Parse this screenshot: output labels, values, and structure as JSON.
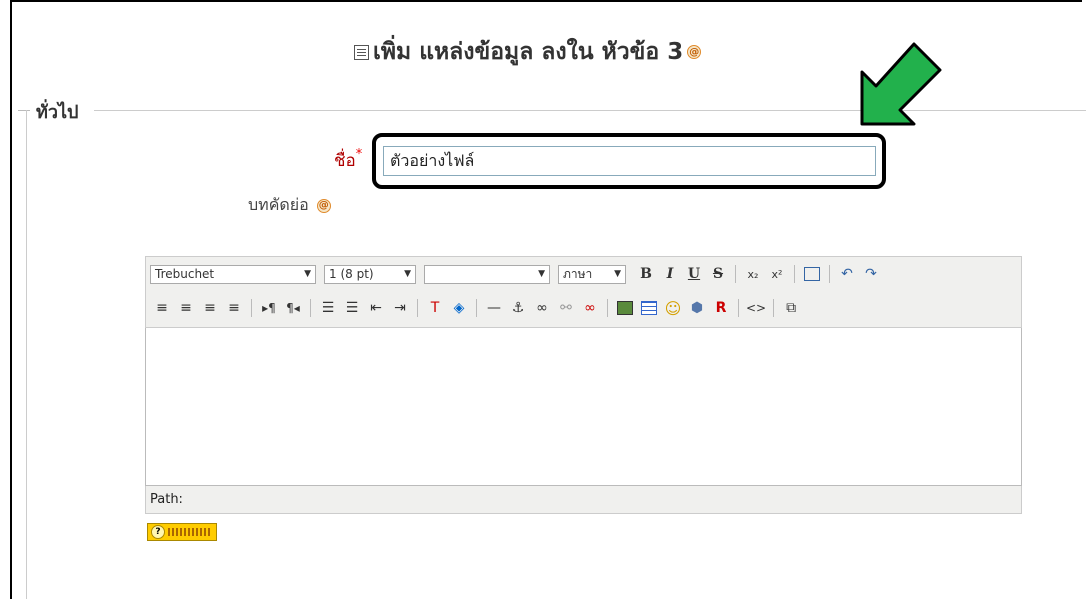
{
  "page": {
    "title": "เพิ่ม แหล่งข้อมูล ลงใน หัวข้อ 3",
    "help_glyph": "@"
  },
  "fieldset": {
    "legend": "ทั่วไป"
  },
  "form": {
    "name_label": "ชื่อ",
    "required_mark": "*",
    "name_value": "ตัวอย่างไฟล์",
    "summary_label": "บทคัดย่อ"
  },
  "editor": {
    "font_family": "Trebuchet",
    "font_size": "1 (8 pt)",
    "format": "",
    "language": "ภาษา",
    "buttons": {
      "bold": "B",
      "italic": "I",
      "underline": "U",
      "strike": "S",
      "subscript": "x₂",
      "superscript": "x²",
      "undo": "↶",
      "redo": "↷",
      "html_source": "<>"
    },
    "path_label": "Path:"
  },
  "help_button": {
    "glyph": "?"
  },
  "colors": {
    "required_red": "#b00000",
    "arrow_green": "#22b14c",
    "help_orange": "#e08a2b",
    "toolbar_bg": "#f0f0ee"
  }
}
